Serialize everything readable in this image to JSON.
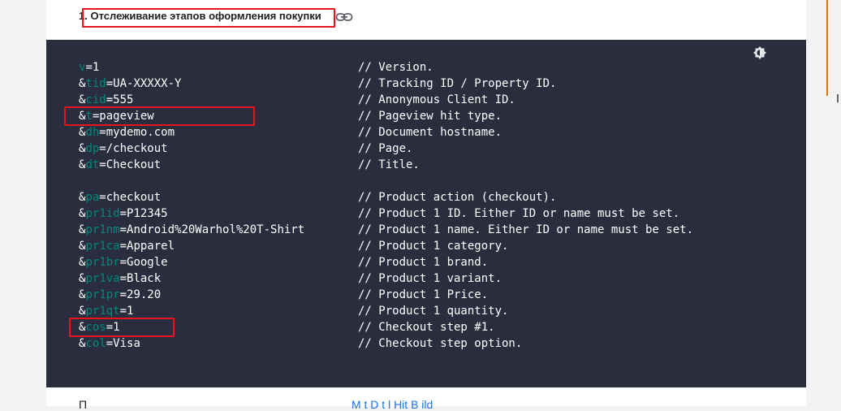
{
  "section": {
    "heading": "1. Отслеживание этапов оформления покупки"
  },
  "code_block": {
    "lines": [
      {
        "amp": "",
        "param": "v",
        "value": "=1",
        "comment": "// Version."
      },
      {
        "amp": "&",
        "param": "tid",
        "value": "=UA-XXXXX-Y",
        "comment": "// Tracking ID / Property ID."
      },
      {
        "amp": "&",
        "param": "cid",
        "value": "=555",
        "comment": "// Anonymous Client ID."
      },
      {
        "amp": "&",
        "param": "t",
        "value": "=pageview",
        "comment": "// Pageview hit type."
      },
      {
        "amp": "&",
        "param": "dh",
        "value": "=mydemo.com",
        "comment": "// Document hostname."
      },
      {
        "amp": "&",
        "param": "dp",
        "value": "=/checkout",
        "comment": "// Page."
      },
      {
        "amp": "&",
        "param": "dt",
        "value": "=Checkout",
        "comment": "// Title."
      },
      {
        "amp": "&",
        "param": "pa",
        "value": "=checkout",
        "comment": "// Product action (checkout)."
      },
      {
        "amp": "&",
        "param": "pr1id",
        "value": "=P12345",
        "comment": "// Product 1 ID. Either ID or name must be set."
      },
      {
        "amp": "&",
        "param": "pr1nm",
        "value": "=Android%20Warhol%20T-Shirt",
        "comment": "// Product 1 name. Either ID or name must be set."
      },
      {
        "amp": "&",
        "param": "pr1ca",
        "value": "=Apparel",
        "comment": "// Product 1 category."
      },
      {
        "amp": "&",
        "param": "pr1br",
        "value": "=Google",
        "comment": "// Product 1 brand."
      },
      {
        "amp": "&",
        "param": "pr1va",
        "value": "=Black",
        "comment": "// Product 1 variant."
      },
      {
        "amp": "&",
        "param": "pr1pr",
        "value": "=29.20",
        "comment": "// Product 1 Price."
      },
      {
        "amp": "&",
        "param": "pr1qt",
        "value": "=1",
        "comment": "// Product 1 quantity."
      },
      {
        "amp": "&",
        "param": "cos",
        "value": "=1",
        "comment": "// Checkout step #1."
      },
      {
        "amp": "&",
        "param": "col",
        "value": "=Visa",
        "comment": "// Checkout step option."
      }
    ]
  },
  "footer": {
    "text_prefix": "П",
    "link_text": "M t D t l Hit B ild"
  },
  "colors": {
    "code_bg": "#292d3e",
    "param": "#00897b",
    "highlight": "#e3161d",
    "accent_bar": "#e37400"
  },
  "icons": [
    "link-icon",
    "theme-toggle-icon"
  ]
}
